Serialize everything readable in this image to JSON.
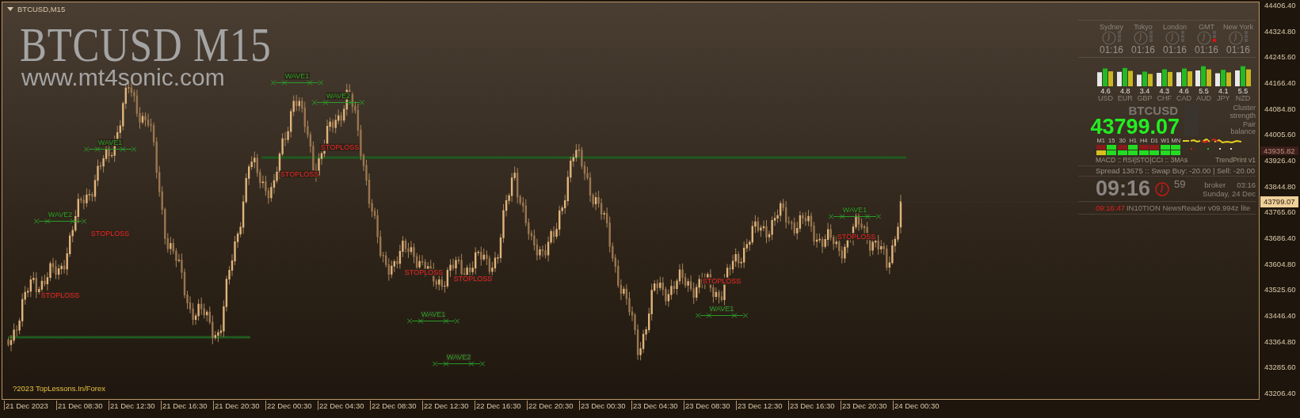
{
  "window": {
    "title": "BTCUSD,M15"
  },
  "chart": {
    "heading": "BTCUSD M15",
    "website": "www.mt4sonic.com",
    "footer": "?2023 TopLessons.In/Forex",
    "annotations": [
      {
        "kind": "wave",
        "label": "WAVE1"
      },
      {
        "kind": "wave",
        "label": "WAVE2"
      },
      {
        "kind": "stoploss",
        "label": "STOPLOSS"
      },
      {
        "kind": "stoploss",
        "label": "STOPLOSS"
      },
      {
        "kind": "wave",
        "label": "WAVE1"
      },
      {
        "kind": "stoploss",
        "label": "STOPLOSS"
      },
      {
        "kind": "wave",
        "label": "WAVE2"
      },
      {
        "kind": "wave",
        "label": "WAVE1"
      },
      {
        "kind": "stoploss",
        "label": "STOPLOSS"
      },
      {
        "kind": "stoploss",
        "label": "STOPLOSS"
      },
      {
        "kind": "stoploss",
        "label": "STOPLOSS"
      },
      {
        "kind": "stoploss",
        "label": "STOPLOSS"
      },
      {
        "kind": "stoploss",
        "label": "STOPLOSS"
      },
      {
        "kind": "wave",
        "label": "WAVE1"
      },
      {
        "kind": "wave",
        "label": "WAVE1"
      },
      {
        "kind": "wave",
        "label": "WAVE2"
      }
    ]
  },
  "dashboard": {
    "sessions": [
      {
        "city": "Sydney",
        "time": "01:16",
        "marked": false
      },
      {
        "city": "Tokyo",
        "time": "01:16",
        "marked": false
      },
      {
        "city": "London",
        "time": "01:16",
        "marked": false
      },
      {
        "city": "GMT",
        "time": "01:16",
        "marked": true
      },
      {
        "city": "New York",
        "time": "01:16",
        "marked": false
      }
    ],
    "currencies": [
      {
        "value": "4.6",
        "code": "USD"
      },
      {
        "value": "4.8",
        "code": "EUR"
      },
      {
        "value": "3.4",
        "code": "GBP"
      },
      {
        "value": "4.3",
        "code": "CHF"
      },
      {
        "value": "4.6",
        "code": "CAD"
      },
      {
        "value": "5.5",
        "code": "AUD"
      },
      {
        "value": "4.1",
        "code": "JPY"
      },
      {
        "value": "5.5",
        "code": "NZD"
      }
    ],
    "symbol": "BTCUSD",
    "price": "43799.07",
    "cluster_label": "Cluster strength",
    "balance_label": "Pair balance",
    "timeframes": [
      {
        "label": "M1",
        "signals": [
          {
            "color": "#8b1a1a"
          },
          {
            "color": "#d8c020"
          }
        ]
      },
      {
        "label": "15",
        "signals": [
          {
            "color": "#22dd22"
          },
          {
            "color": "#22dd22"
          }
        ]
      },
      {
        "label": "30",
        "signals": [
          {
            "color": "#8b1a1a"
          },
          {
            "color": "#22dd22"
          }
        ]
      },
      {
        "label": "H1",
        "signals": [
          {
            "color": "#22dd22"
          },
          {
            "color": "#22dd22"
          }
        ]
      },
      {
        "label": "H4",
        "signals": [
          {
            "color": "#8b1a1a"
          },
          {
            "color": "#22dd22"
          }
        ]
      },
      {
        "label": "D1",
        "signals": [
          {
            "color": "#8b1a1a"
          },
          {
            "color": "#22dd22"
          }
        ]
      },
      {
        "label": "W1",
        "signals": [
          {
            "color": "#22dd22"
          },
          {
            "color": "#22dd22"
          }
        ]
      },
      {
        "label": "MN",
        "signals": [
          {
            "color": "#22dd22"
          },
          {
            "color": "#22dd22"
          }
        ]
      }
    ],
    "indicators_label": "MACD :: RSI|STO|CCI :: 3MAs",
    "trend_label": "TrendPrint v1",
    "spread_text": "Spread 13675 :: Swap Buy: -20.00 | Sell: -20.00",
    "time": "09:16",
    "seconds": "59",
    "broker_label": "broker",
    "broker_time": "03:16",
    "date": "Sunday, 24 Dec",
    "news_time": "09:16:47",
    "news_label": "IN10TION NewsReader v09.994z lite"
  },
  "price_axis": {
    "ticks": [
      "44406.40",
      "44324.80",
      "44245.60",
      "44166.40",
      "44084.80",
      "44005.60",
      "43926.40",
      "43844.80",
      "43765.60",
      "43686.40",
      "43604.80",
      "43525.60",
      "43446.40",
      "43364.80",
      "43285.60",
      "43206.40"
    ],
    "markers": [
      {
        "kind": "line",
        "label": "43935.82"
      },
      {
        "kind": "bid",
        "label": "43799.07"
      }
    ]
  },
  "time_axis": {
    "labels": [
      "21 Dec 2023",
      "21 Dec 08:30",
      "21 Dec 12:30",
      "21 Dec 16:30",
      "21 Dec 20:30",
      "22 Dec 00:30",
      "22 Dec 04:30",
      "22 Dec 08:30",
      "22 Dec 12:30",
      "22 Dec 16:30",
      "22 Dec 20:30",
      "23 Dec 00:30",
      "23 Dec 04:30",
      "23 Dec 08:30",
      "23 Dec 12:30",
      "23 Dec 16:30",
      "23 Dec 20:30",
      "24 Dec 00:30"
    ]
  }
}
